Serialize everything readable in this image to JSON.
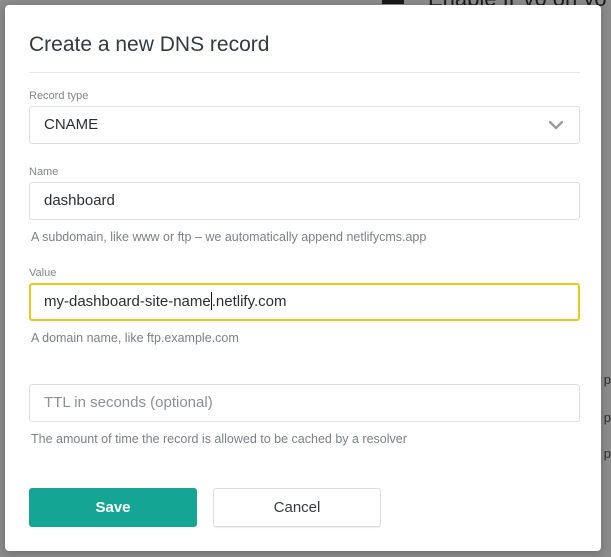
{
  "background": {
    "heading_fragment": "Enable IPv6 on yo",
    "side_fragments": [
      "p",
      "p",
      "p"
    ]
  },
  "modal": {
    "title": "Create a new DNS record",
    "record_type": {
      "label": "Record type",
      "selected": "CNAME"
    },
    "name": {
      "label": "Name",
      "value": "dashboard",
      "help": "A subdomain, like www or ftp – we automatically append netlifycms.app"
    },
    "value": {
      "label": "Value",
      "value_before_caret": "my-dashboard-site-name",
      "value_after_caret": ".netlify.com",
      "help": "A domain name, like ftp.example.com"
    },
    "ttl": {
      "placeholder": "TTL in seconds (optional)",
      "help": "The amount of time the record is allowed to be cached by a resolver"
    },
    "buttons": {
      "save": "Save",
      "cancel": "Cancel"
    }
  },
  "colors": {
    "primary": "#14a594",
    "focus_border": "#f2c41d",
    "overlay": "rgba(0,0,0,0.45)"
  },
  "icons": {
    "select_arrow": "chevron-down-icon"
  }
}
